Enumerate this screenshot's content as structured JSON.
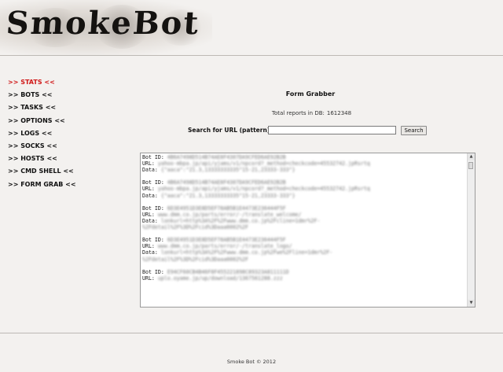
{
  "logo": {
    "text": "SmokeBot"
  },
  "nav": [
    {
      "label": ">> STATS <<",
      "active": true
    },
    {
      "label": ">> BOTS <<"
    },
    {
      "label": ">> TASKS <<"
    },
    {
      "label": ">> OPTIONS <<"
    },
    {
      "label": ">> LOGS <<"
    },
    {
      "label": ">> SOCKS <<"
    },
    {
      "label": ">> HOSTS <<"
    },
    {
      "label": ">> CMD SHELL <<"
    },
    {
      "label": ">> FORM GRAB <<"
    }
  ],
  "main": {
    "title": "Form Grabber",
    "total_label": "Total reports in DB:",
    "total_value": "1612348",
    "search_label": "Search for URL (pattern):",
    "search_value": "",
    "search_button": "Search"
  },
  "reports": [
    {
      "id_label": "Bot ID:",
      "id": "4B6A7498D514B74AE8F4307DA9CFED6AE92B2B",
      "url_label": "URL:",
      "url": "yahoo-mbpa.jp/api/yjams/v1/npcord?_method=checkcode=45532742.jpRsrtq",
      "data_label": "Data:",
      "data": "{\"aaca\":\"21.3,13333333335\"15-21,23333-333\"}"
    },
    {
      "id_label": "Bot ID:",
      "id": "4B6A7498D514B74AE8F4307DA9CFED6AE92B2B",
      "url_label": "URL:",
      "url": "yahoo-mbpa.jp/api/yjams/v1/npcord?_method=checkcode=45532742.jpRsrtq",
      "data_label": "Data:",
      "data": "{\"aaca\":\"21.3,13333333335\"15-21,23333-333\"}"
    },
    {
      "id_label": "Bot ID:",
      "id": "6D3E4951D3E8D5EF78AB5B1E4473E236444F5F",
      "url_label": "URL:",
      "url": "www.dmm.co.jp/parts/error/-/translate_welcome/",
      "data_label": "Data:",
      "data": "lonkurl=http%3A%2F%2Fwww.dmm.co.jp%2Fcline=1dmr%2F-",
      "extra": "%2Fdetail%2F%3D%2Fcid%3Daaa0002%2F"
    },
    {
      "id_label": "Bot ID:",
      "id": "6D3E4951D3E8D5EF78AB5B1E4473E236444F5F",
      "url_label": "URL:",
      "url": "www.dmm.co.jp/parts/error/-/translate_logo/",
      "data_label": "Data:",
      "data": "lonkurl=http%3A%2F%2Fwww.dmm.co.jp%2Fwe%2Fline=1dmr%2F-",
      "extra": "%2Fdetail%2F%3D%2Fcid%3Daaa0002%2F"
    },
    {
      "id_label": "Bot ID:",
      "id": "E94CF60CB4B46F8F455221898C89323A811111D",
      "url_label": "URL:",
      "url": "uplo.oyame.jp/up/download/1367561288.zzz"
    }
  ],
  "footer": {
    "text": "Smoke Bot © 2012"
  }
}
